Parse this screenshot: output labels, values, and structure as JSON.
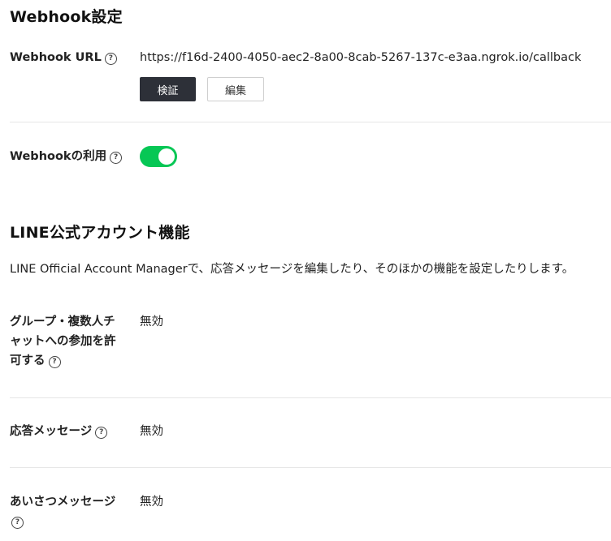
{
  "webhook_section": {
    "title": "Webhook設定",
    "url_label": "Webhook URL",
    "url_value": "https://f16d-2400-4050-aec2-8a00-8cab-5267-137c-e3aa.ngrok.io/callback",
    "verify_button": "検証",
    "edit_button": "編集",
    "use_label": "Webhookの利用",
    "use_enabled": true
  },
  "help_icon": "?",
  "oa_section": {
    "title": "LINE公式アカウント機能",
    "description": "LINE Official Account Managerで、応答メッセージを編集したり、そのほかの機能を設定したりします。",
    "items": [
      {
        "label_lines": [
          "グループ・複数人チ",
          "ャットへの参加を許",
          "可する"
        ],
        "value": "無効"
      },
      {
        "label_lines": [
          "応答メッセージ"
        ],
        "value": "無効"
      },
      {
        "label_lines": [
          "あいさつメッセージ"
        ],
        "value": "無効"
      }
    ]
  }
}
